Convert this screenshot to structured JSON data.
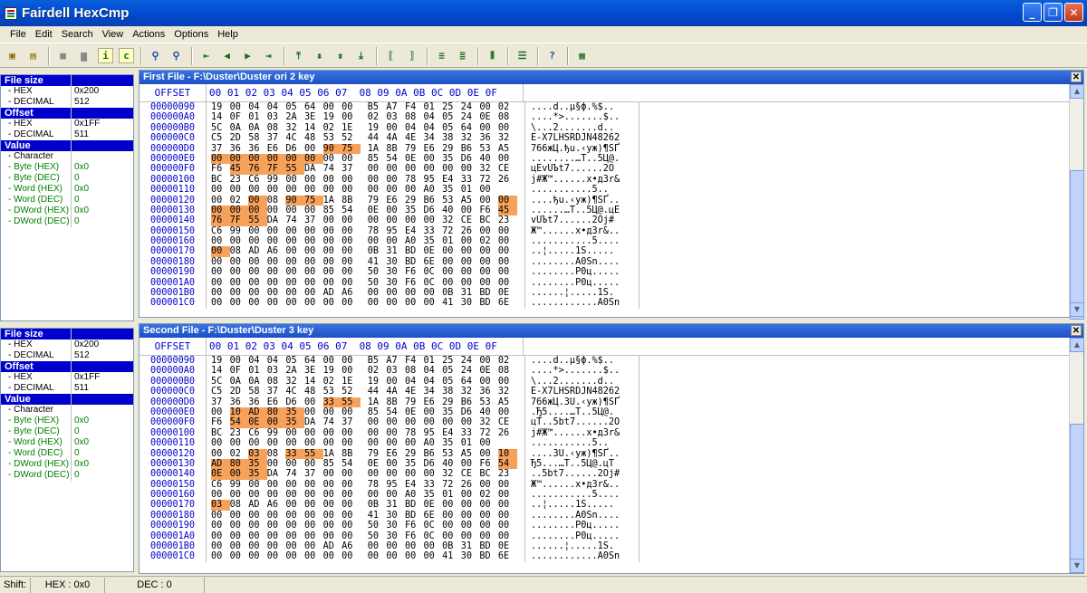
{
  "app": {
    "title": "Fairdell HexCmp"
  },
  "menu": [
    "File",
    "Edit",
    "Search",
    "View",
    "Actions",
    "Options",
    "Help"
  ],
  "toolbar": {
    "info_label": "i",
    "compare_label": "c"
  },
  "panel1": {
    "rows": [
      {
        "t": "hdr",
        "k": "File size",
        "v": ""
      },
      {
        "t": "sub",
        "k": "- HEX",
        "v": "0x200"
      },
      {
        "t": "sub",
        "k": "- DECIMAL",
        "v": "512"
      },
      {
        "t": "hdr",
        "k": "Offset",
        "v": ""
      },
      {
        "t": "sub",
        "k": "- HEX",
        "v": "0x1FF"
      },
      {
        "t": "sub",
        "k": "- DECIMAL",
        "v": "511"
      },
      {
        "t": "hdr",
        "k": "Value",
        "v": ""
      },
      {
        "t": "sub",
        "k": "- Character",
        "v": ""
      },
      {
        "t": "green",
        "k": "- Byte (HEX)",
        "v": "0x0"
      },
      {
        "t": "green",
        "k": "- Byte (DEC)",
        "v": "0"
      },
      {
        "t": "green",
        "k": "- Word (HEX)",
        "v": "0x0"
      },
      {
        "t": "green",
        "k": "- Word (DEC)",
        "v": "0"
      },
      {
        "t": "green",
        "k": "- DWord (HEX)",
        "v": "0x0"
      },
      {
        "t": "green",
        "k": "- DWord (DEC)",
        "v": "0"
      }
    ]
  },
  "panel2": {
    "rows": [
      {
        "t": "hdr",
        "k": "File size",
        "v": ""
      },
      {
        "t": "sub",
        "k": "- HEX",
        "v": "0x200"
      },
      {
        "t": "sub",
        "k": "- DECIMAL",
        "v": "512"
      },
      {
        "t": "hdr",
        "k": "Offset",
        "v": ""
      },
      {
        "t": "sub",
        "k": "- HEX",
        "v": "0x1FF"
      },
      {
        "t": "sub",
        "k": "- DECIMAL",
        "v": "511"
      },
      {
        "t": "hdr",
        "k": "Value",
        "v": ""
      },
      {
        "t": "sub",
        "k": "- Character",
        "v": ""
      },
      {
        "t": "green",
        "k": "- Byte (HEX)",
        "v": "0x0"
      },
      {
        "t": "green",
        "k": "- Byte (DEC)",
        "v": "0"
      },
      {
        "t": "green",
        "k": "- Word (HEX)",
        "v": "0x0"
      },
      {
        "t": "green",
        "k": "- Word (DEC)",
        "v": "0"
      },
      {
        "t": "green",
        "k": "- DWord (HEX)",
        "v": "0x0"
      },
      {
        "t": "green",
        "k": "- DWord (DEC)",
        "v": "0"
      }
    ]
  },
  "hex_header": {
    "offset_label": "OFFSET",
    "columns": "00 01 02 03 04 05 06 07  08 09 0A 0B 0C 0D 0E 0F"
  },
  "file1": {
    "caption": "First File - F:\\Duster\\Duster ori 2 key",
    "rows": [
      {
        "addr": "00000090",
        "hex": "19 00 04 04 05 64 00 00 B5 A7 F4 01 25 24 00 02",
        "ascii": "....d..µ§ф.%$..",
        "diff": []
      },
      {
        "addr": "000000A0",
        "hex": "14 0F 01 03 2A 3E 19 00 02 03 08 04 05 24 0E 08",
        "ascii": "....*>.......$..",
        "diff": []
      },
      {
        "addr": "000000B0",
        "hex": "5C 0A 0A 08 32 14 02 1E 19 00 04 04 05 64 00 00",
        "ascii": "\\...2.......d..",
        "diff": []
      },
      {
        "addr": "000000C0",
        "hex": "C5 2D 58 37 4C 48 53 52 44 4A 4E 34 38 32 36 32",
        "ascii": "Е-X7LHSRDJN48262",
        "diff": []
      },
      {
        "addr": "000000D0",
        "hex": "37 36 36 E6 D6 00 90 75 1A 8B 79 E6 29 B6 53 A5",
        "ascii": "766жЦ.ђu.‹yж)¶SҐ",
        "diff": [
          6,
          7
        ]
      },
      {
        "addr": "000000E0",
        "hex": "00 00 00 00 00 00 00 00 85 54 0E 00 35 D6 40 00",
        "ascii": "........…T..5Ц@.",
        "diff": [
          0,
          1,
          2,
          3,
          4,
          5
        ]
      },
      {
        "addr": "000000F0",
        "hex": "F6 45 76 7F 55 DA 74 37 00 00 00 00 00 00 32 CE",
        "ascii": "цEvUЪt7......2О",
        "diff": [
          1,
          2,
          3,
          4
        ]
      },
      {
        "addr": "00000100",
        "hex": "BC 23 C6 99 00 00 00 00 00 00 78 95 E4 33 72 26",
        "ascii": "ј#Ж™......x•д3r&",
        "diff": []
      },
      {
        "addr": "00000110",
        "hex": "00 00 00 00 00 00 00 00 00 00 00 A0 35 01 00",
        "ascii": "...........5..",
        "diff": []
      },
      {
        "addr": "00000120",
        "hex": "00 02 00 08 90 75 1A 8B 79 E6 29 B6 53 A5 00 00",
        "ascii": "....ђu.‹yж)¶SҐ..",
        "diff": [
          2,
          4,
          5,
          15
        ]
      },
      {
        "addr": "00000130",
        "hex": "00 00 00 00 00 00 85 54 0E 00 35 D6 40 00 F6 45",
        "ascii": "......…T..5Ц@.цE",
        "diff": [
          0,
          1,
          2,
          15
        ]
      },
      {
        "addr": "00000140",
        "hex": "76 7F 55 DA 74 37 00 00 00 00 00 00 32 CE BC 23",
        "ascii": "vUЪt7......2Оj#",
        "diff": [
          0,
          1,
          2
        ]
      },
      {
        "addr": "00000150",
        "hex": "C6 99 00 00 00 00 00 00 78 95 E4 33 72 26 00 00",
        "ascii": "Ж™......x•д3r&..",
        "diff": []
      },
      {
        "addr": "00000160",
        "hex": "00 00 00 00 00 00 00 00 00 00 A0 35 01 00 02 00",
        "ascii": "...........5....",
        "diff": []
      },
      {
        "addr": "00000170",
        "hex": "00 08 AD A6 00 00 00 00 0B 31 BD 0E 00 00 00 00",
        "ascii": "..­¦.....1Ѕ.....",
        "diff": [
          0
        ]
      },
      {
        "addr": "00000180",
        "hex": "00 00 00 00 00 00 00 00 41 30 BD 6E 00 00 00 00",
        "ascii": "........A0Sn....",
        "diff": []
      },
      {
        "addr": "00000190",
        "hex": "00 00 00 00 00 00 00 00 50 30 F6 0C 00 00 00 00",
        "ascii": "........P0ц.....",
        "diff": []
      },
      {
        "addr": "000001A0",
        "hex": "00 00 00 00 00 00 00 00 50 30 F6 0C 00 00 00 00",
        "ascii": "........P0ц.....",
        "diff": []
      },
      {
        "addr": "000001B0",
        "hex": "00 00 00 00 00 00 AD A6 00 00 00 00 0B 31 BD 0E",
        "ascii": "......­¦.....1S.",
        "diff": []
      },
      {
        "addr": "000001C0",
        "hex": "00 00 00 00 00 00 00 00 00 00 00 00 41 30 BD 6E",
        "ascii": "............A0Sn",
        "diff": []
      }
    ]
  },
  "file2": {
    "caption": "Second File - F:\\Duster\\Duster 3 key",
    "rows": [
      {
        "addr": "00000090",
        "hex": "19 00 04 04 05 64 00 00 B5 A7 F4 01 25 24 00 02",
        "ascii": "....d..µ§ф.%$..",
        "diff": []
      },
      {
        "addr": "000000A0",
        "hex": "14 0F 01 03 2A 3E 19 00 02 03 08 04 05 24 0E 08",
        "ascii": "....*>.......$..",
        "diff": []
      },
      {
        "addr": "000000B0",
        "hex": "5C 0A 0A 08 32 14 02 1E 19 00 04 04 05 64 00 00",
        "ascii": "\\...2.......d..",
        "diff": []
      },
      {
        "addr": "000000C0",
        "hex": "C5 2D 58 37 4C 48 53 52 44 4A 4E 34 38 32 36 32",
        "ascii": "Е-X7LHSRDJN48262",
        "diff": []
      },
      {
        "addr": "000000D0",
        "hex": "37 36 36 E6 D6 00 33 55 1A 8B 79 E6 29 B6 53 A5",
        "ascii": "766жЦ.3U.‹yж)¶SҐ",
        "diff": [
          6,
          7
        ]
      },
      {
        "addr": "000000E0",
        "hex": "00 10 AD 80 35 00 00 00 85 54 0E 00 35 D6 40 00",
        "ascii": ".­Ђ5....…T..5Ц@.",
        "diff": [
          1,
          2,
          3,
          4
        ]
      },
      {
        "addr": "000000F0",
        "hex": "F6 54 0E 00 35 DA 74 37 00 00 00 00 00 00 32 CE",
        "ascii": "цT..5bt7......2О",
        "diff": [
          1,
          2,
          3,
          4
        ]
      },
      {
        "addr": "00000100",
        "hex": "BC 23 C6 99 00 00 00 00 00 00 78 95 E4 33 72 26",
        "ascii": "ј#Ж™......x•д3r&",
        "diff": []
      },
      {
        "addr": "00000110",
        "hex": "00 00 00 00 00 00 00 00 00 00 00 A0 35 01 00",
        "ascii": "...........5..",
        "diff": []
      },
      {
        "addr": "00000120",
        "hex": "00 02 03 08 33 55 1A 8B 79 E6 29 B6 53 A5 00 10",
        "ascii": "....3U.‹yж)¶SҐ..",
        "diff": [
          2,
          4,
          5,
          15
        ]
      },
      {
        "addr": "00000130",
        "hex": "AD 80 35 00 00 00 85 54 0E 00 35 D6 40 00 F6 54",
        "ascii": "­Ђ5...…T..5Ц@.цT",
        "diff": [
          0,
          1,
          2,
          15
        ]
      },
      {
        "addr": "00000140",
        "hex": "0E 00 35 DA 74 37 00 00 00 00 00 00 32 CE BC 23",
        "ascii": "..5bt7......2Оj#",
        "diff": [
          0,
          1,
          2
        ]
      },
      {
        "addr": "00000150",
        "hex": "C6 99 00 00 00 00 00 00 78 95 E4 33 72 26 00 00",
        "ascii": "Ж™......x•д3r&..",
        "diff": []
      },
      {
        "addr": "00000160",
        "hex": "00 00 00 00 00 00 00 00 00 00 A0 35 01 00 02 00",
        "ascii": "...........5....",
        "diff": []
      },
      {
        "addr": "00000170",
        "hex": "03 08 AD A6 00 00 00 00 0B 31 BD 0E 00 00 00 00",
        "ascii": "..­¦.....1S.....",
        "diff": [
          0
        ]
      },
      {
        "addr": "00000180",
        "hex": "00 00 00 00 00 00 00 00 41 30 BD 6E 00 00 00 00",
        "ascii": "........A0Sn....",
        "diff": []
      },
      {
        "addr": "00000190",
        "hex": "00 00 00 00 00 00 00 00 50 30 F6 0C 00 00 00 00",
        "ascii": "........P0ц.....",
        "diff": []
      },
      {
        "addr": "000001A0",
        "hex": "00 00 00 00 00 00 00 00 50 30 F6 0C 00 00 00 00",
        "ascii": "........P0ц.....",
        "diff": []
      },
      {
        "addr": "000001B0",
        "hex": "00 00 00 00 00 00 AD A6 00 00 00 00 0B 31 BD 0E",
        "ascii": "......­¦.....1S.",
        "diff": []
      },
      {
        "addr": "000001C0",
        "hex": "00 00 00 00 00 00 00 00 00 00 00 00 41 30 BD 6E",
        "ascii": "............A0Sn",
        "diff": []
      }
    ]
  },
  "status": {
    "shift": "Shift:",
    "hex": "HEX : 0x0",
    "dec": "DEC : 0"
  },
  "colors": {
    "diff": "#f7a25a",
    "caption": "#1c4fc4",
    "panel_header": "#0000cc",
    "address": "#0000cc",
    "green": "#008000"
  }
}
